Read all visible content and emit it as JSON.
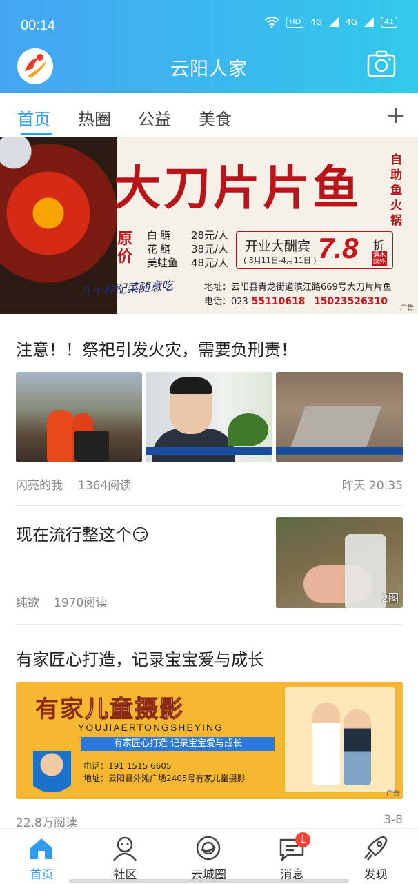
{
  "status_bar": {
    "time": "00:14",
    "hd": "HD",
    "net1": "4G",
    "net2": "4G",
    "battery": "41"
  },
  "header": {
    "title": "云阳人家"
  },
  "tabs": {
    "items": [
      "首页",
      "热圈",
      "公益",
      "美食"
    ],
    "active": "首页",
    "add": "+"
  },
  "banner": {
    "title": "大刀片片鱼",
    "side_text": "自助鱼火锅",
    "price_label": "原价",
    "prices": [
      {
        "name": "白 鲢",
        "price": "28元/人"
      },
      {
        "name": "花 鲢",
        "price": "38元/人"
      },
      {
        "name": "美蛙鱼",
        "price": "48元/人"
      }
    ],
    "promo_text": "开业大酬宾",
    "promo_dates": "( 3月11日-4月11日 )",
    "promo_discount": "7.8",
    "promo_unit": "折",
    "promo_note": "酒水除外",
    "slogan": "几十种配菜随意吃",
    "address": "地址：云阳县青龙街道滨江路669号大刀片片鱼",
    "phone_label": "电话：023-",
    "phone1": "55110618",
    "phone2": "15023526310",
    "ad_tag": "广告"
  },
  "articles": [
    {
      "title": "注意！！祭祀引发火灾，需要负刑责！",
      "author": "闪亮的我",
      "reads": "1364阅读",
      "time": "昨天 20:35"
    },
    {
      "title": "现在流行整这个😏",
      "author": "纯欲",
      "reads": "1970阅读",
      "image_count": "2图"
    },
    {
      "title": "有家匠心打造，记录宝宝爱与成长",
      "reads": "22.8万阅读",
      "time": "3-8"
    }
  ],
  "ad2": {
    "brand_a": "有家",
    "brand_b": "儿童摄影",
    "pinyin": "YOUJIAERTONGSHEYING",
    "slogan": "有家匠心打造  记录宝宝爱与成长",
    "phone": "电话：191 1515 6605",
    "address": "地址：云阳县外滩广场2405号有家儿童摄影",
    "ad_tag": "广告"
  },
  "bottom_nav": {
    "items": [
      {
        "label": "首页",
        "icon": "home-icon"
      },
      {
        "label": "社区",
        "icon": "community-icon"
      },
      {
        "label": "云城圈",
        "icon": "cloud-city-icon"
      },
      {
        "label": "消息",
        "icon": "message-icon"
      },
      {
        "label": "发现",
        "icon": "rocket-icon"
      }
    ],
    "message_badge": "1"
  },
  "colors": {
    "accent": "#2f9cf0",
    "header_start": "#44a6f2",
    "header_end": "#32c9ea",
    "badge": "#f24437"
  }
}
